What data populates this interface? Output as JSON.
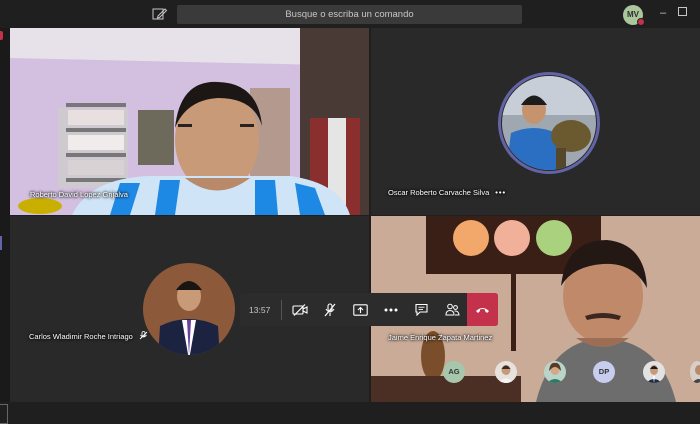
{
  "titlebar": {
    "search_placeholder": "Busque o escriba un comando",
    "user_initials": "MV"
  },
  "participants": [
    {
      "name": "Roberto David Lopez Grijalva"
    },
    {
      "name": "Oscar Roberto Carvache Silva",
      "more": "•••"
    },
    {
      "name": "Carlos Wladimir Roche Intriago"
    },
    {
      "name": "Jaime Enrique Zapata Martinez"
    }
  ],
  "call": {
    "timer": "13:57"
  },
  "roster": [
    {
      "initials": "AG",
      "color": "#a6c7ab"
    },
    {
      "initials": "DP",
      "color": "#c7cdef"
    }
  ],
  "colors": {
    "accent": "#6264a7",
    "hangup": "#c4314b"
  }
}
